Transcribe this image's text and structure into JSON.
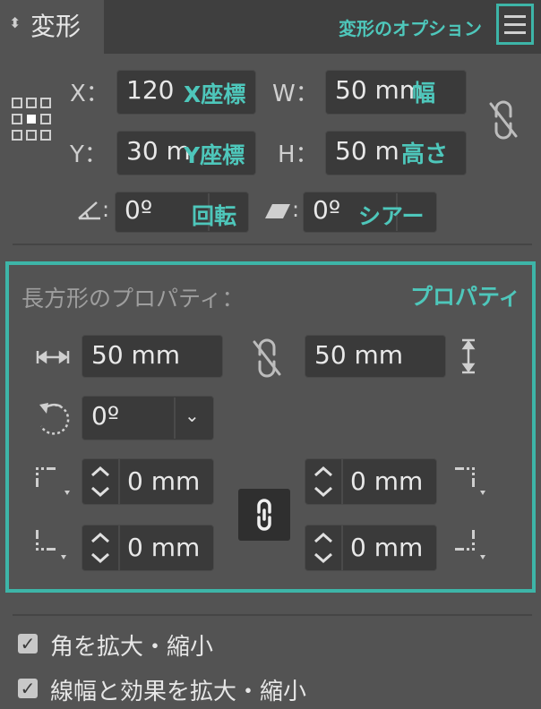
{
  "panel": {
    "title": "変形"
  },
  "transform": {
    "x_label": "X：",
    "x_value": "120",
    "y_label": "Y：",
    "y_value": "30 m",
    "w_label": "W：",
    "w_value": "50 mm",
    "h_label": "H：",
    "h_value": "50 m",
    "rotate_value": "0º",
    "shear_value": "0º"
  },
  "annotations": {
    "options": "変形のオプション",
    "x": "X座標",
    "y": "Y座標",
    "w": "幅",
    "h": "高さ",
    "rotate": "回転",
    "shear": "シアー",
    "properties": "プロパティ"
  },
  "rect_props": {
    "title": "長方形のプロパティ：",
    "width": "50 mm",
    "height": "50 mm",
    "rotation": "0º",
    "corner_tl": "0 mm",
    "corner_tr": "0 mm",
    "corner_bl": "0 mm",
    "corner_br": "0 mm"
  },
  "options": {
    "scale_corners": "角を拡大・縮小",
    "scale_strokes": "線幅と効果を拡大・縮小"
  },
  "colors": {
    "accent": "#3db5a8",
    "panel_bg": "#535353",
    "field_bg": "#3a3a3a"
  }
}
